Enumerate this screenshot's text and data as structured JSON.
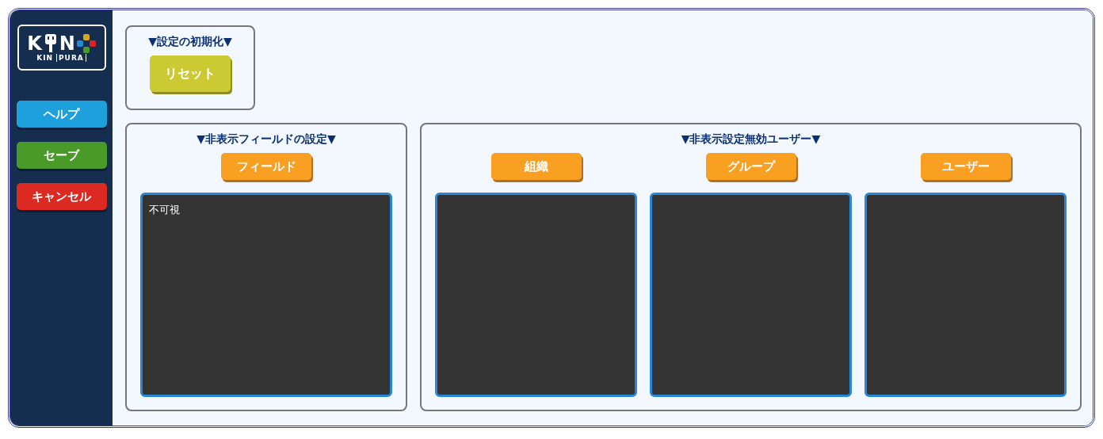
{
  "logo": {
    "letter_1": "K",
    "letter_2": "N",
    "word_1": "KIN",
    "word_2": "PURA"
  },
  "sidebar": {
    "buttons": [
      {
        "label": "ヘルプ",
        "kind": "help"
      },
      {
        "label": "セーブ",
        "kind": "save"
      },
      {
        "label": "キャンセル",
        "kind": "cancel"
      }
    ]
  },
  "reset_section": {
    "title": "▼設定の初期化▼",
    "button": "リセット"
  },
  "hidden_fields_section": {
    "title": "▼非表示フィールドの設定▼",
    "lists": [
      {
        "button": "フィールド",
        "items": [
          "不可視"
        ]
      }
    ]
  },
  "exempt_users_section": {
    "title": "▼非表示設定無効ユーザー▼",
    "lists": [
      {
        "button": "組織"
      },
      {
        "button": "グループ"
      },
      {
        "button": "ユーザー"
      }
    ]
  }
}
